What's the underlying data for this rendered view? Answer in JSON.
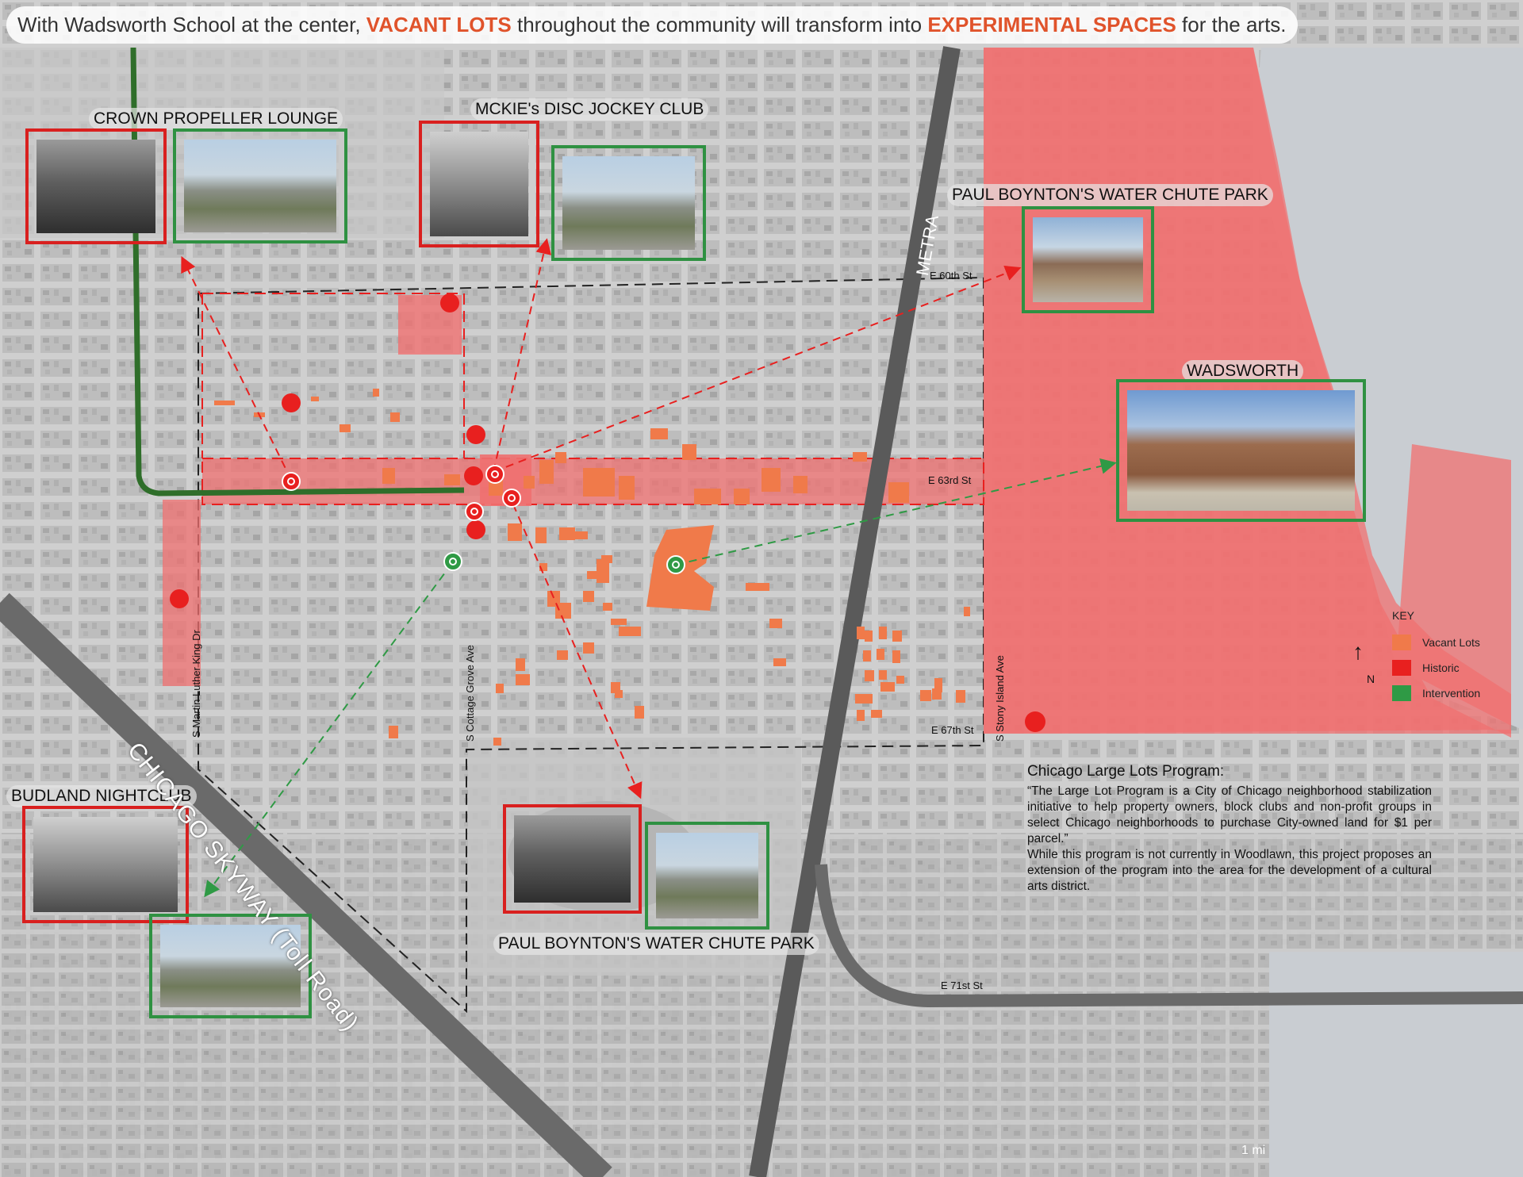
{
  "headline": {
    "prefix": "With Wadsworth School at the center, ",
    "highlight1": "VACANT LOTS",
    "middle": " throughout the community will transform into ",
    "highlight2": "EXPERIMENTAL SPACES",
    "suffix": " for the arts."
  },
  "photo_titles": {
    "crown": "CROWN PROPELLER LOUNGE",
    "mckie": "MCKIE's DISC JOCKEY CLUB",
    "boynton_top": "PAUL BOYNTON'S WATER CHUTE PARK",
    "wadsworth": "WADSWORTH",
    "budland": "BUDLAND NIGHTCLUB",
    "boynton_bottom": "PAUL BOYNTON'S WATER CHUTE PARK"
  },
  "streets": {
    "e60": "E 60th St",
    "e63": "E 63rd St",
    "e67": "E 67th St",
    "e71": "E 71st St",
    "mlk": "S Martin Luther King Dr",
    "cottage": "S Cottage Grove Ave",
    "stony": "S Stony Island Ave",
    "metra": "METRA",
    "skyway": "CHICAGO SKYWAY (Toll Road)"
  },
  "key": {
    "title": "KEY",
    "items": [
      {
        "label": "Vacant Lots",
        "color": "#f07a4a"
      },
      {
        "label": "Historic",
        "color": "#e8201f"
      },
      {
        "label": "Intervention",
        "color": "#2f9a45"
      }
    ],
    "north": "N"
  },
  "program": {
    "title": "Chicago Large Lots Program:",
    "quote": "“The Large Lot Program is a City of Chicago neighborhood stabilization initiative to help property owners, block clubs and non-profit groups in select Chicago neighborhoods to purchase City-owned land for $1 per parcel.”",
    "body": "While this program is not currently in Woodlawn, this project proposes an extension of the program into the area for the development of a cultural arts district."
  },
  "scale": "1 mi",
  "colors": {
    "historic": "#e8201f",
    "intervention": "#2f9a45",
    "vacant": "#f07a4a",
    "overlay": "#f07070"
  }
}
